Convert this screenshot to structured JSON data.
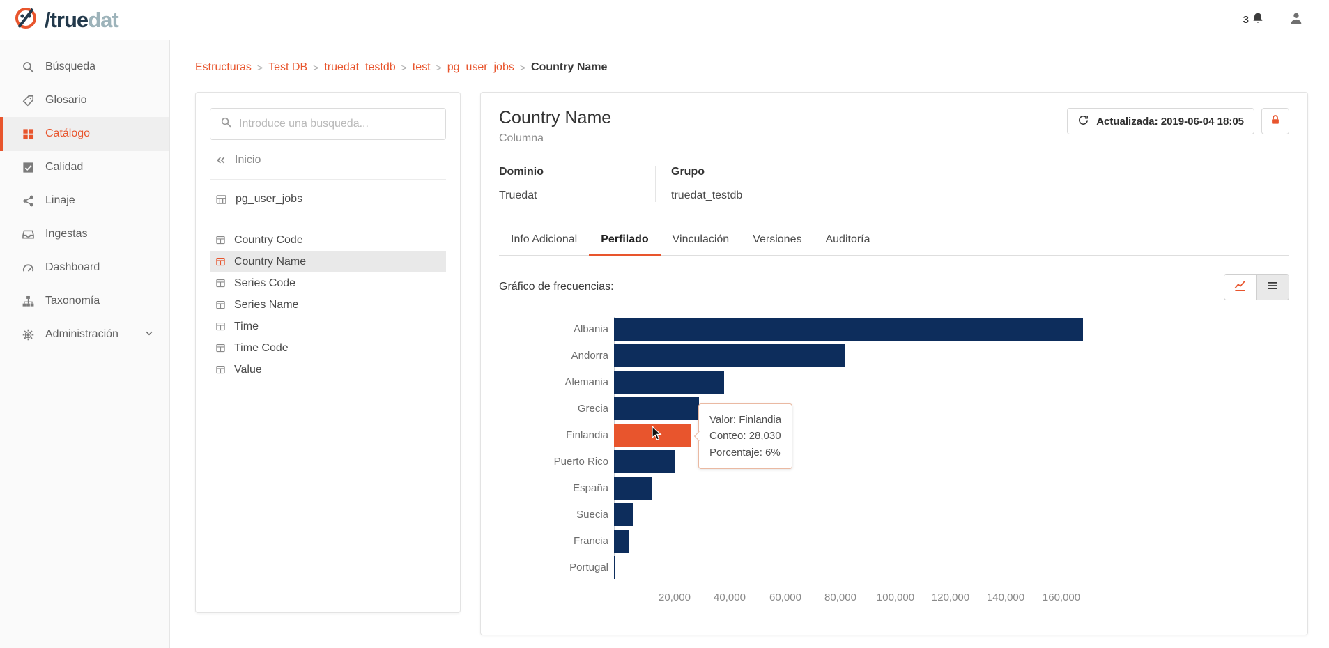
{
  "header": {
    "brand_true": "/true",
    "brand_dat": "dat",
    "notification_count": "3"
  },
  "sidebar": {
    "items": [
      {
        "label": "Búsqueda",
        "icon": "search-icon",
        "active": false
      },
      {
        "label": "Glosario",
        "icon": "tag-icon",
        "active": false
      },
      {
        "label": "Catálogo",
        "icon": "grid-icon",
        "active": true
      },
      {
        "label": "Calidad",
        "icon": "check-square-icon",
        "active": false
      },
      {
        "label": "Linaje",
        "icon": "share-icon",
        "active": false
      },
      {
        "label": "Ingestas",
        "icon": "inbox-icon",
        "active": false
      },
      {
        "label": "Dashboard",
        "icon": "gauge-icon",
        "active": false
      },
      {
        "label": "Taxonomía",
        "icon": "sitemap-icon",
        "active": false
      },
      {
        "label": "Administración",
        "icon": "gear-icon",
        "active": false,
        "has_submenu": true
      }
    ]
  },
  "breadcrumb": {
    "separator": ">",
    "links": [
      "Estructuras",
      "Test DB",
      "truedat_testdb",
      "test",
      "pg_user_jobs"
    ],
    "current": "Country Name"
  },
  "structure_panel": {
    "search_placeholder": "Introduce una busqueda...",
    "home_label": "Inicio",
    "parent_item": "pg_user_jobs",
    "columns": [
      "Country Code",
      "Country Name",
      "Series Code",
      "Series Name",
      "Time",
      "Time Code",
      "Value"
    ],
    "selected_column": "Country Name"
  },
  "detail": {
    "title": "Country Name",
    "type_label": "Columna",
    "updated_button": "Actualizada: 2019-06-04 18:05",
    "fields": [
      {
        "label": "Dominio",
        "value": "Truedat"
      },
      {
        "label": "Grupo",
        "value": "truedat_testdb"
      }
    ],
    "tabs": [
      "Info Adicional",
      "Perfilado",
      "Vinculación",
      "Versiones",
      "Auditoría"
    ],
    "active_tab": "Perfilado",
    "section_title": "Gráfico de frecuencias:"
  },
  "tooltip": {
    "lines": [
      "Valor: Finlandia",
      "Conteo: 28,030",
      "Porcentaje: 6%"
    ]
  },
  "colors": {
    "accent_orange": "#e8552d",
    "bar_navy": "#0d2d5c"
  },
  "chart_data": {
    "type": "bar",
    "orientation": "horizontal",
    "title": "Gráfico de frecuencias",
    "categories": [
      "Albania",
      "Andorra",
      "Alemania",
      "Grecia",
      "Finlandia",
      "Puerto Rico",
      "España",
      "Suecia",
      "Francia",
      "Portugal"
    ],
    "values": [
      170000,
      83500,
      39800,
      30800,
      28030,
      22200,
      13800,
      7100,
      5200,
      600
    ],
    "bar_color": "#0d2d5c",
    "highlight": {
      "index": 4,
      "category": "Finlandia",
      "color": "#e8552d",
      "count": "28,030",
      "percentage": "6%"
    },
    "xticks": [
      20000,
      40000,
      60000,
      80000,
      100000,
      120000,
      140000,
      160000
    ],
    "xtick_labels": [
      "20,000",
      "40,000",
      "60,000",
      "80,000",
      "100,000",
      "120,000",
      "140,000",
      "160,000"
    ],
    "xlim": [
      0,
      172000
    ],
    "grid": false,
    "legend": false
  }
}
